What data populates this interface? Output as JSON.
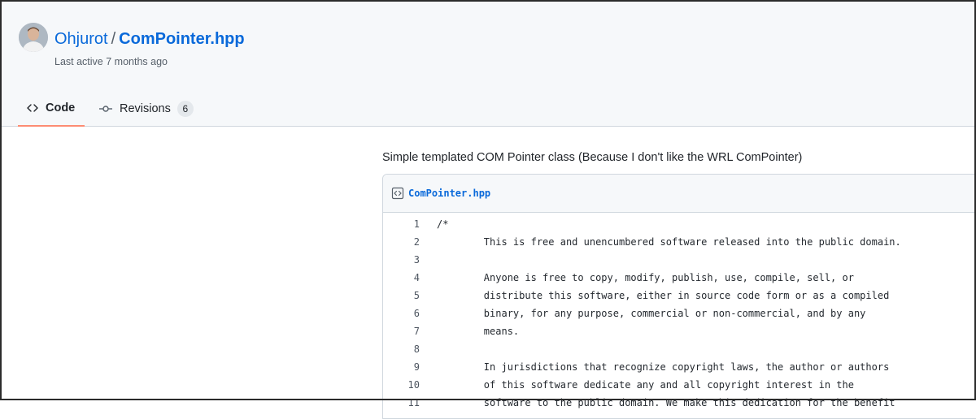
{
  "header": {
    "owner": "Ohjurot",
    "separator": "/",
    "gist_name": "ComPointer.hpp",
    "last_active": "Last active 7 months ago"
  },
  "tabs": [
    {
      "label": "Code",
      "icon": "code-icon",
      "selected": true
    },
    {
      "label": "Revisions",
      "icon": "git-commit-icon",
      "count": "6"
    }
  ],
  "description": "Simple templated COM Pointer class (Because I don't like the WRL ComPointer)",
  "file": {
    "name": "ComPointer.hpp",
    "icon": "file-code-icon",
    "lines": [
      {
        "n": "1",
        "text": "/*"
      },
      {
        "n": "2",
        "text": "        This is free and unencumbered software released into the public domain."
      },
      {
        "n": "3",
        "text": ""
      },
      {
        "n": "4",
        "text": "        Anyone is free to copy, modify, publish, use, compile, sell, or"
      },
      {
        "n": "5",
        "text": "        distribute this software, either in source code form or as a compiled"
      },
      {
        "n": "6",
        "text": "        binary, for any purpose, commercial or non-commercial, and by any"
      },
      {
        "n": "7",
        "text": "        means."
      },
      {
        "n": "8",
        "text": ""
      },
      {
        "n": "9",
        "text": "        In jurisdictions that recognize copyright laws, the author or authors"
      },
      {
        "n": "10",
        "text": "        of this software dedicate any and all copyright interest in the"
      },
      {
        "n": "11",
        "text": "        software to the public domain. We make this dedication for the benefit"
      }
    ]
  },
  "colors": {
    "link": "#0969da",
    "tab_underline": "#fd8c73",
    "header_bg": "#f6f8fa"
  }
}
